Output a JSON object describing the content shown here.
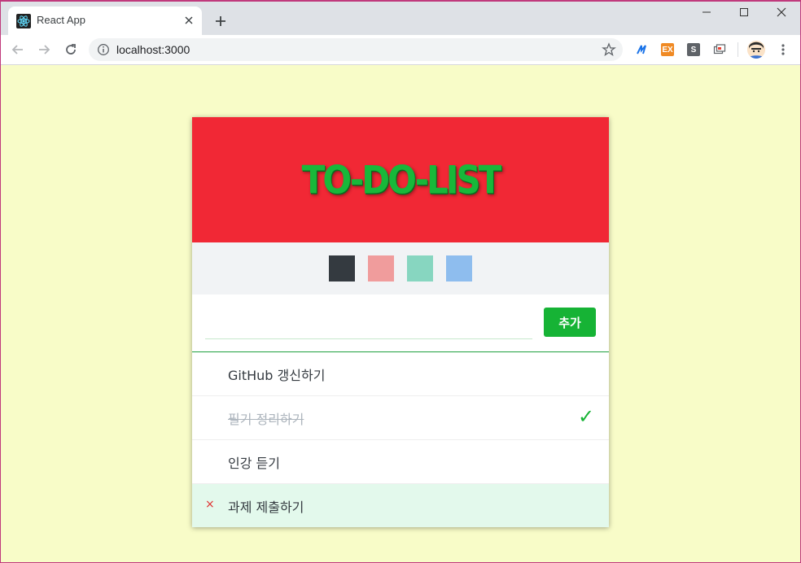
{
  "browser": {
    "tab_title": "React App",
    "url": "localhost:3000",
    "accent": "#dee1e6"
  },
  "app": {
    "title": "TO-DO-LIST",
    "header_color": "#f12835",
    "title_color": "#18b83a",
    "palette": [
      {
        "name": "dark",
        "color": "#343a40"
      },
      {
        "name": "pink",
        "color": "#f09c9c"
      },
      {
        "name": "mint",
        "color": "#87d6c0"
      },
      {
        "name": "blue",
        "color": "#8ebdee"
      }
    ],
    "input": {
      "value": "",
      "placeholder": ""
    },
    "add_label": "추가",
    "add_color": "#16b335",
    "todos": [
      {
        "text": "GitHub 갱신하기",
        "checked": false,
        "hover": false
      },
      {
        "text": "필기 정리하기",
        "checked": true,
        "hover": false
      },
      {
        "text": "인강 듣기",
        "checked": false,
        "hover": false
      },
      {
        "text": "과제 제출하기",
        "checked": false,
        "hover": true
      }
    ],
    "remove_glyph": "×",
    "check_glyph": "✓"
  }
}
